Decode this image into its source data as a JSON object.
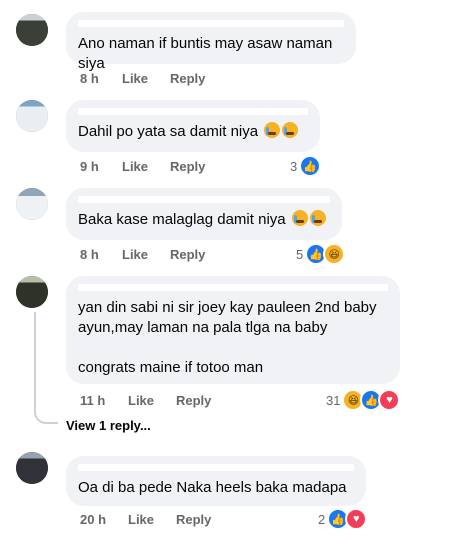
{
  "comments": [
    {
      "text": "Ano naman if buntis may asaw naman siya",
      "time": "8 h",
      "like": "Like",
      "reply": "Reply",
      "reaction_count": ""
    },
    {
      "text": "Dahil po yata sa damit niya",
      "time": "9 h",
      "like": "Like",
      "reply": "Reply",
      "reaction_count": "3"
    },
    {
      "text": "Baka kase malaglag damit niya",
      "time": "8 h",
      "like": "Like",
      "reply": "Reply",
      "reaction_count": "5"
    },
    {
      "text": "yan din sabi ni sir joey kay pauleen 2nd baby ayun,may laman na pala tlga na baby\n\ncongrats maine if totoo man",
      "time": "11 h",
      "like": "Like",
      "reply": "Reply",
      "reaction_count": "31"
    },
    {
      "text": "Oa di ba pede Naka heels baka madapa",
      "time": "20 h",
      "like": "Like",
      "reply": "Reply",
      "reaction_count": "2"
    }
  ],
  "view_replies": "View 1 reply...",
  "colors": {
    "bubble": "#f0f2f5",
    "like": "#1877f2",
    "haha": "#f7b125",
    "heart": "#f33e58"
  },
  "icons": {
    "like": "thumbs-up-icon",
    "haha": "laughing-face-icon",
    "heart": "heart-icon"
  }
}
